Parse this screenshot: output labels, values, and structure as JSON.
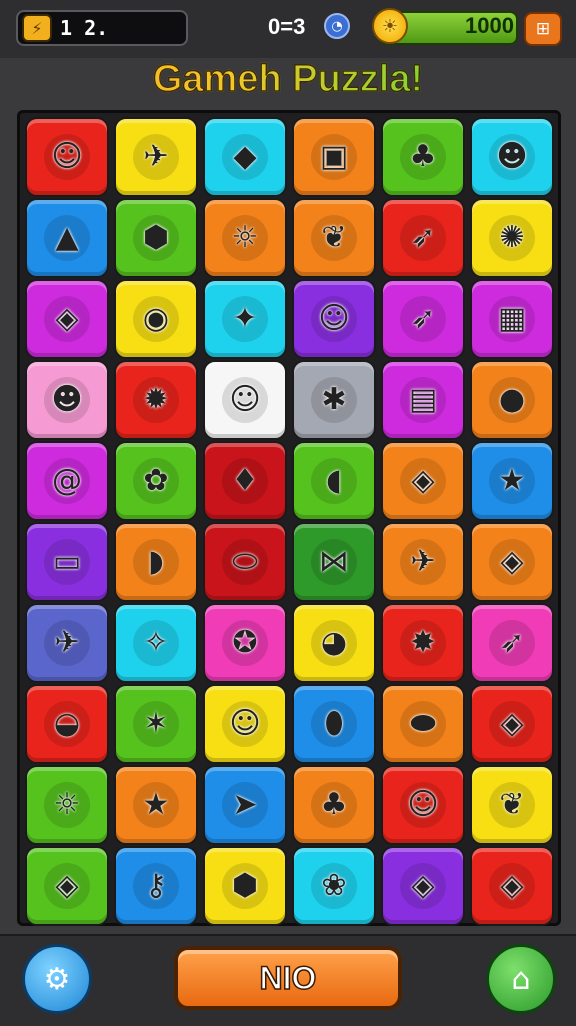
{
  "header": {
    "level_text": "1 2.",
    "timer_text": "0=3",
    "coins_text": "1000"
  },
  "title": "Gameh Puzzla!",
  "footer": {
    "main_button_label": "NIO"
  },
  "colors": {
    "red": "#e8241c",
    "yellow": "#f7df14",
    "cyan": "#1ed2ee",
    "orange": "#f4821a",
    "green": "#55c21e",
    "blue": "#1e8ee8",
    "magenta": "#cf2bde",
    "purple": "#8a2fe0",
    "pink": "#f59ad2",
    "white": "#f6f6f6",
    "gray": "#a4a8b2",
    "darkred": "#c8141a",
    "darkgreen": "#2e9a2a",
    "slate": "#5a66cc",
    "hotpink": "#f03cb6"
  },
  "board": {
    "rows": [
      [
        {
          "color": "red",
          "icon": "cat-face"
        },
        {
          "color": "yellow",
          "icon": "bird"
        },
        {
          "color": "cyan",
          "icon": "pink-fish"
        },
        {
          "color": "orange",
          "icon": "robot-box"
        },
        {
          "color": "green",
          "icon": "palm-tree"
        },
        {
          "color": "cyan",
          "icon": "blue-cat"
        }
      ],
      [
        {
          "color": "blue",
          "icon": "shark"
        },
        {
          "color": "green",
          "icon": "turtle"
        },
        {
          "color": "orange",
          "icon": "sun-face"
        },
        {
          "color": "orange",
          "icon": "leaf"
        },
        {
          "color": "red",
          "icon": "rocket"
        },
        {
          "color": "yellow",
          "icon": "green-blob"
        }
      ],
      [
        {
          "color": "magenta",
          "icon": "fish"
        },
        {
          "color": "yellow",
          "icon": "orange-fish"
        },
        {
          "color": "cyan",
          "icon": "star-bird"
        },
        {
          "color": "purple",
          "icon": "green-face"
        },
        {
          "color": "magenta",
          "icon": "rocket"
        },
        {
          "color": "magenta",
          "icon": "robot"
        }
      ],
      [
        {
          "color": "pink",
          "icon": "orange-face"
        },
        {
          "color": "red",
          "icon": "spiky-ball"
        },
        {
          "color": "white",
          "icon": "cat-face"
        },
        {
          "color": "gray",
          "icon": "palm-star"
        },
        {
          "color": "magenta",
          "icon": "scroll"
        },
        {
          "color": "orange",
          "icon": "berry"
        }
      ],
      [
        {
          "color": "magenta",
          "icon": "swirl"
        },
        {
          "color": "green",
          "icon": "squid"
        },
        {
          "color": "darkred",
          "icon": "seed"
        },
        {
          "color": "green",
          "icon": "duck"
        },
        {
          "color": "orange",
          "icon": "fish"
        },
        {
          "color": "blue",
          "icon": "star"
        }
      ],
      [
        {
          "color": "purple",
          "icon": "computer"
        },
        {
          "color": "orange",
          "icon": "banana"
        },
        {
          "color": "darkred",
          "icon": "capsule"
        },
        {
          "color": "darkgreen",
          "icon": "bow"
        },
        {
          "color": "orange",
          "icon": "bird"
        },
        {
          "color": "orange",
          "icon": "fish"
        }
      ],
      [
        {
          "color": "slate",
          "icon": "bird"
        },
        {
          "color": "cyan",
          "icon": "purple-bird"
        },
        {
          "color": "hotpink",
          "icon": "star-fish"
        },
        {
          "color": "yellow",
          "icon": "dog"
        },
        {
          "color": "red",
          "icon": "sun"
        },
        {
          "color": "hotpink",
          "icon": "rocket"
        }
      ],
      [
        {
          "color": "red",
          "icon": "bowl"
        },
        {
          "color": "green",
          "icon": "blue-bird"
        },
        {
          "color": "yellow",
          "icon": "cat-face"
        },
        {
          "color": "blue",
          "icon": "balloon"
        },
        {
          "color": "orange",
          "icon": "bean"
        },
        {
          "color": "red",
          "icon": "fish"
        }
      ],
      [
        {
          "color": "green",
          "icon": "sun-face"
        },
        {
          "color": "orange",
          "icon": "star"
        },
        {
          "color": "blue",
          "icon": "yellow-bird"
        },
        {
          "color": "orange",
          "icon": "palm-tree"
        },
        {
          "color": "red",
          "icon": "cat-face"
        },
        {
          "color": "yellow",
          "icon": "leaf"
        }
      ],
      [
        {
          "color": "green",
          "icon": "fish"
        },
        {
          "color": "blue",
          "icon": "key"
        },
        {
          "color": "yellow",
          "icon": "turtle"
        },
        {
          "color": "cyan",
          "icon": "cherry"
        },
        {
          "color": "purple",
          "icon": "fish"
        },
        {
          "color": "red",
          "icon": "fish"
        }
      ]
    ]
  }
}
